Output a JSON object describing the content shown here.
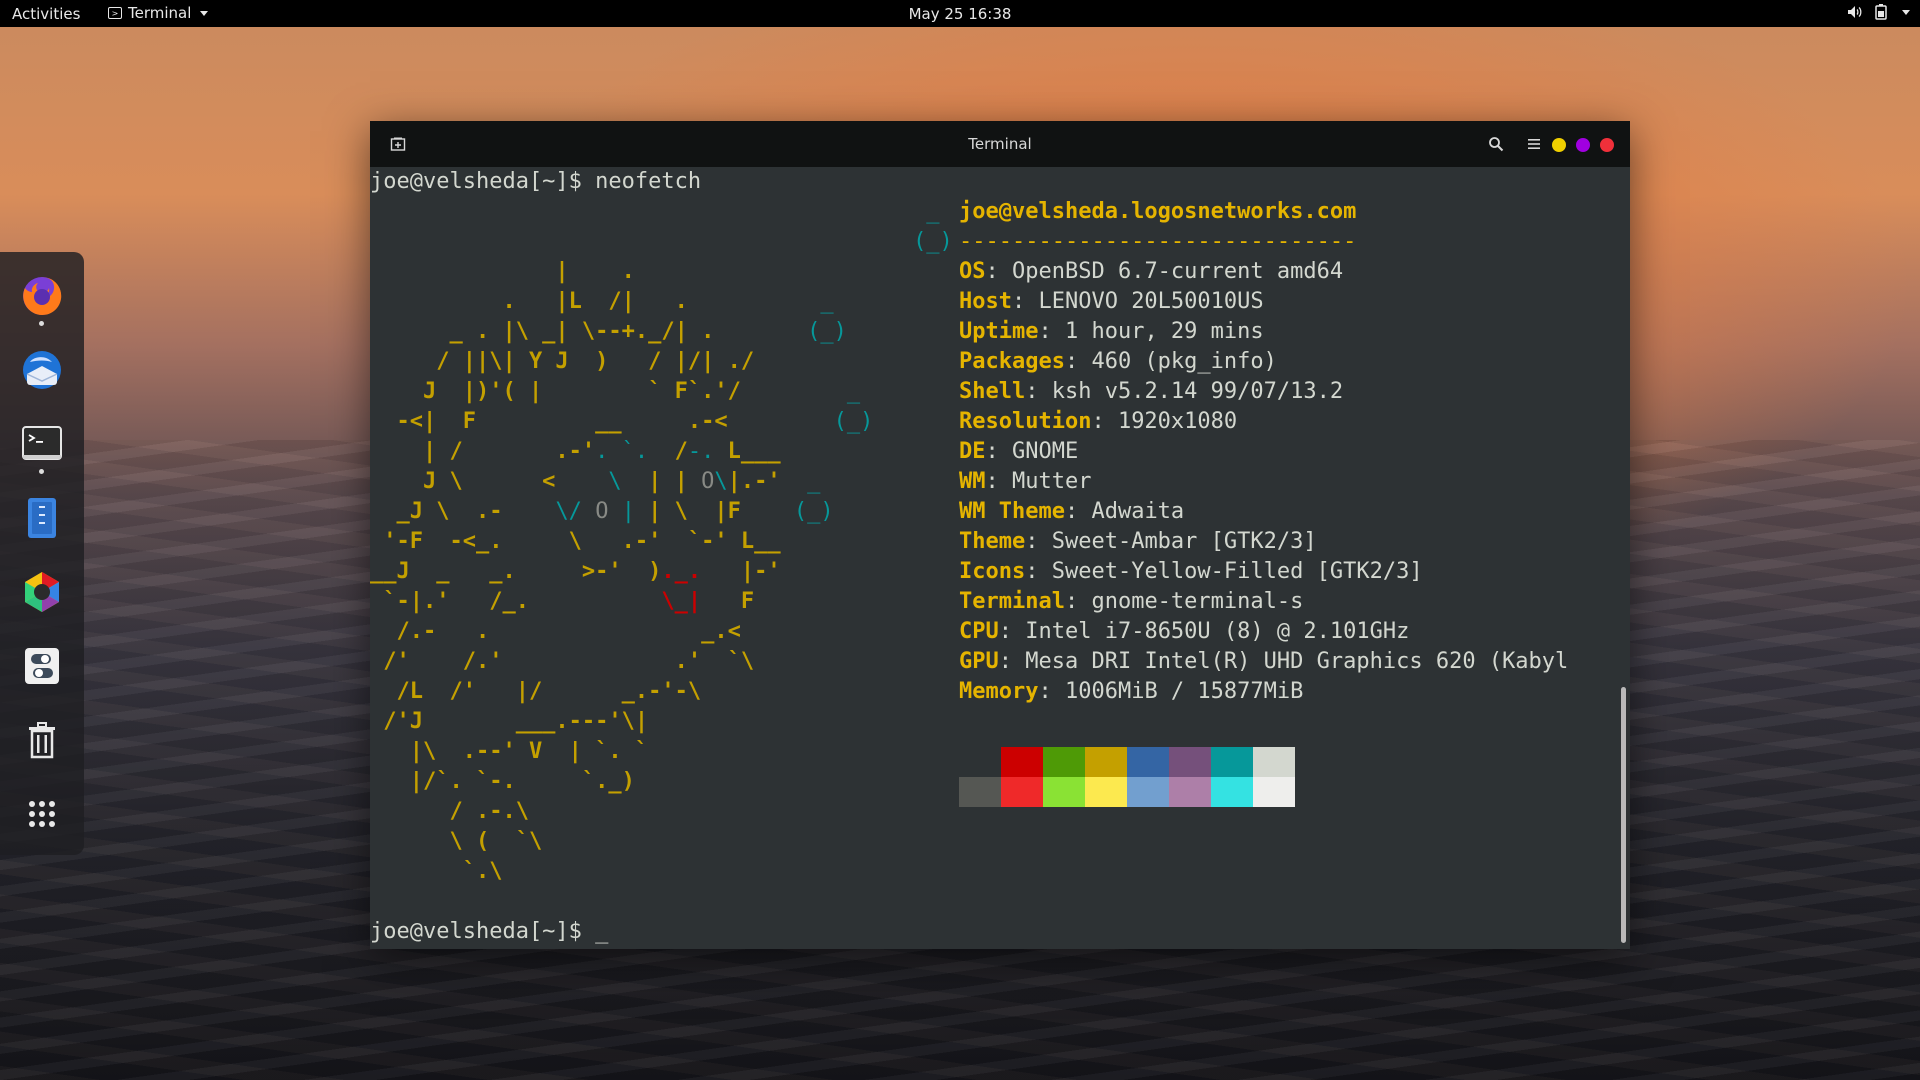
{
  "topbar": {
    "activities": "Activities",
    "app_name": "Terminal",
    "clock": "May 25  16:38",
    "icons": [
      "volume-icon",
      "battery-icon",
      "system-menu-caret-icon"
    ]
  },
  "dock": {
    "items": [
      {
        "name": "firefox",
        "running": true
      },
      {
        "name": "thunderbird",
        "running": false
      },
      {
        "name": "terminal",
        "running": true
      },
      {
        "name": "files",
        "running": false
      },
      {
        "name": "software-center",
        "running": false
      },
      {
        "name": "settings",
        "running": false
      },
      {
        "name": "trash",
        "running": false
      },
      {
        "name": "show-apps",
        "running": false
      }
    ]
  },
  "window": {
    "title": "Terminal",
    "controls": {
      "minimize_color": "#f0d000",
      "maximize_color": "#a000e0",
      "close_color": "#f0303a"
    }
  },
  "terminal": {
    "prompt": "joe@velsheda[~]$ ",
    "command": "neofetch",
    "cursor": "_",
    "info_header": "joe@velsheda.logosnetworks.com",
    "info_separator": "------------------------------",
    "info": [
      {
        "key": "OS",
        "value": ": OpenBSD 6.7-current amd64"
      },
      {
        "key": "Host",
        "value": ": LENOVO 20L50010US"
      },
      {
        "key": "Uptime",
        "value": ": 1 hour, 29 mins"
      },
      {
        "key": "Packages",
        "value": ": 460 (pkg_info)"
      },
      {
        "key": "Shell",
        "value": ": ksh v5.2.14 99/07/13.2"
      },
      {
        "key": "Resolution",
        "value": ": 1920x1080"
      },
      {
        "key": "DE",
        "value": ": GNOME"
      },
      {
        "key": "WM",
        "value": ": Mutter"
      },
      {
        "key": "WM Theme",
        "value": ": Adwaita"
      },
      {
        "key": "Theme",
        "value": ": Sweet-Ambar [GTK2/3]"
      },
      {
        "key": "Icons",
        "value": ": Sweet-Yellow-Filled [GTK2/3]"
      },
      {
        "key": "Terminal",
        "value": ": gnome-terminal-s"
      },
      {
        "key": "CPU",
        "value": ": Intel i7-8650U (8) @ 2.101GHz"
      },
      {
        "key": "GPU",
        "value": ": Mesa DRI Intel(R) UHD Graphics 620 (Kabyl"
      },
      {
        "key": "Memory",
        "value": ": 1006MiB / 15877MiB"
      }
    ],
    "palette": {
      "normal": [
        "#2d3234",
        "#cc0000",
        "#4e9a06",
        "#c4a000",
        "#3465a4",
        "#75507b",
        "#06989a",
        "#d3d7cf"
      ],
      "bright": [
        "#555753",
        "#ef2929",
        "#8ae234",
        "#fce94f",
        "#729fcf",
        "#ad7fa8",
        "#34e2e2",
        "#eeeeec"
      ]
    }
  }
}
